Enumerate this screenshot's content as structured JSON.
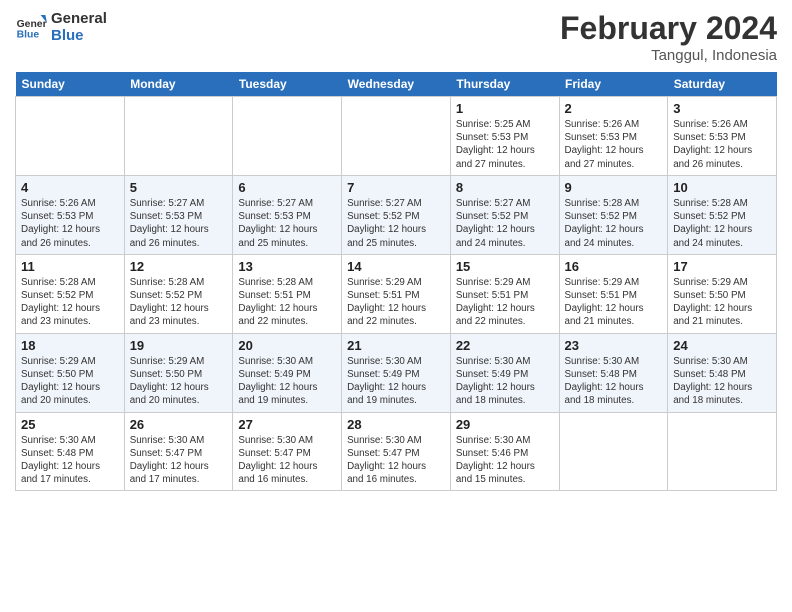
{
  "header": {
    "logo_line1": "General",
    "logo_line2": "Blue",
    "month_title": "February 2024",
    "location": "Tanggul, Indonesia"
  },
  "days_of_week": [
    "Sunday",
    "Monday",
    "Tuesday",
    "Wednesday",
    "Thursday",
    "Friday",
    "Saturday"
  ],
  "weeks": [
    [
      {
        "day": "",
        "info": ""
      },
      {
        "day": "",
        "info": ""
      },
      {
        "day": "",
        "info": ""
      },
      {
        "day": "",
        "info": ""
      },
      {
        "day": "1",
        "info": "Sunrise: 5:25 AM\nSunset: 5:53 PM\nDaylight: 12 hours and 27 minutes."
      },
      {
        "day": "2",
        "info": "Sunrise: 5:26 AM\nSunset: 5:53 PM\nDaylight: 12 hours and 27 minutes."
      },
      {
        "day": "3",
        "info": "Sunrise: 5:26 AM\nSunset: 5:53 PM\nDaylight: 12 hours and 26 minutes."
      }
    ],
    [
      {
        "day": "4",
        "info": "Sunrise: 5:26 AM\nSunset: 5:53 PM\nDaylight: 12 hours and 26 minutes."
      },
      {
        "day": "5",
        "info": "Sunrise: 5:27 AM\nSunset: 5:53 PM\nDaylight: 12 hours and 26 minutes."
      },
      {
        "day": "6",
        "info": "Sunrise: 5:27 AM\nSunset: 5:53 PM\nDaylight: 12 hours and 25 minutes."
      },
      {
        "day": "7",
        "info": "Sunrise: 5:27 AM\nSunset: 5:52 PM\nDaylight: 12 hours and 25 minutes."
      },
      {
        "day": "8",
        "info": "Sunrise: 5:27 AM\nSunset: 5:52 PM\nDaylight: 12 hours and 24 minutes."
      },
      {
        "day": "9",
        "info": "Sunrise: 5:28 AM\nSunset: 5:52 PM\nDaylight: 12 hours and 24 minutes."
      },
      {
        "day": "10",
        "info": "Sunrise: 5:28 AM\nSunset: 5:52 PM\nDaylight: 12 hours and 24 minutes."
      }
    ],
    [
      {
        "day": "11",
        "info": "Sunrise: 5:28 AM\nSunset: 5:52 PM\nDaylight: 12 hours and 23 minutes."
      },
      {
        "day": "12",
        "info": "Sunrise: 5:28 AM\nSunset: 5:52 PM\nDaylight: 12 hours and 23 minutes."
      },
      {
        "day": "13",
        "info": "Sunrise: 5:28 AM\nSunset: 5:51 PM\nDaylight: 12 hours and 22 minutes."
      },
      {
        "day": "14",
        "info": "Sunrise: 5:29 AM\nSunset: 5:51 PM\nDaylight: 12 hours and 22 minutes."
      },
      {
        "day": "15",
        "info": "Sunrise: 5:29 AM\nSunset: 5:51 PM\nDaylight: 12 hours and 22 minutes."
      },
      {
        "day": "16",
        "info": "Sunrise: 5:29 AM\nSunset: 5:51 PM\nDaylight: 12 hours and 21 minutes."
      },
      {
        "day": "17",
        "info": "Sunrise: 5:29 AM\nSunset: 5:50 PM\nDaylight: 12 hours and 21 minutes."
      }
    ],
    [
      {
        "day": "18",
        "info": "Sunrise: 5:29 AM\nSunset: 5:50 PM\nDaylight: 12 hours and 20 minutes."
      },
      {
        "day": "19",
        "info": "Sunrise: 5:29 AM\nSunset: 5:50 PM\nDaylight: 12 hours and 20 minutes."
      },
      {
        "day": "20",
        "info": "Sunrise: 5:30 AM\nSunset: 5:49 PM\nDaylight: 12 hours and 19 minutes."
      },
      {
        "day": "21",
        "info": "Sunrise: 5:30 AM\nSunset: 5:49 PM\nDaylight: 12 hours and 19 minutes."
      },
      {
        "day": "22",
        "info": "Sunrise: 5:30 AM\nSunset: 5:49 PM\nDaylight: 12 hours and 18 minutes."
      },
      {
        "day": "23",
        "info": "Sunrise: 5:30 AM\nSunset: 5:48 PM\nDaylight: 12 hours and 18 minutes."
      },
      {
        "day": "24",
        "info": "Sunrise: 5:30 AM\nSunset: 5:48 PM\nDaylight: 12 hours and 18 minutes."
      }
    ],
    [
      {
        "day": "25",
        "info": "Sunrise: 5:30 AM\nSunset: 5:48 PM\nDaylight: 12 hours and 17 minutes."
      },
      {
        "day": "26",
        "info": "Sunrise: 5:30 AM\nSunset: 5:47 PM\nDaylight: 12 hours and 17 minutes."
      },
      {
        "day": "27",
        "info": "Sunrise: 5:30 AM\nSunset: 5:47 PM\nDaylight: 12 hours and 16 minutes."
      },
      {
        "day": "28",
        "info": "Sunrise: 5:30 AM\nSunset: 5:47 PM\nDaylight: 12 hours and 16 minutes."
      },
      {
        "day": "29",
        "info": "Sunrise: 5:30 AM\nSunset: 5:46 PM\nDaylight: 12 hours and 15 minutes."
      },
      {
        "day": "",
        "info": ""
      },
      {
        "day": "",
        "info": ""
      }
    ]
  ]
}
